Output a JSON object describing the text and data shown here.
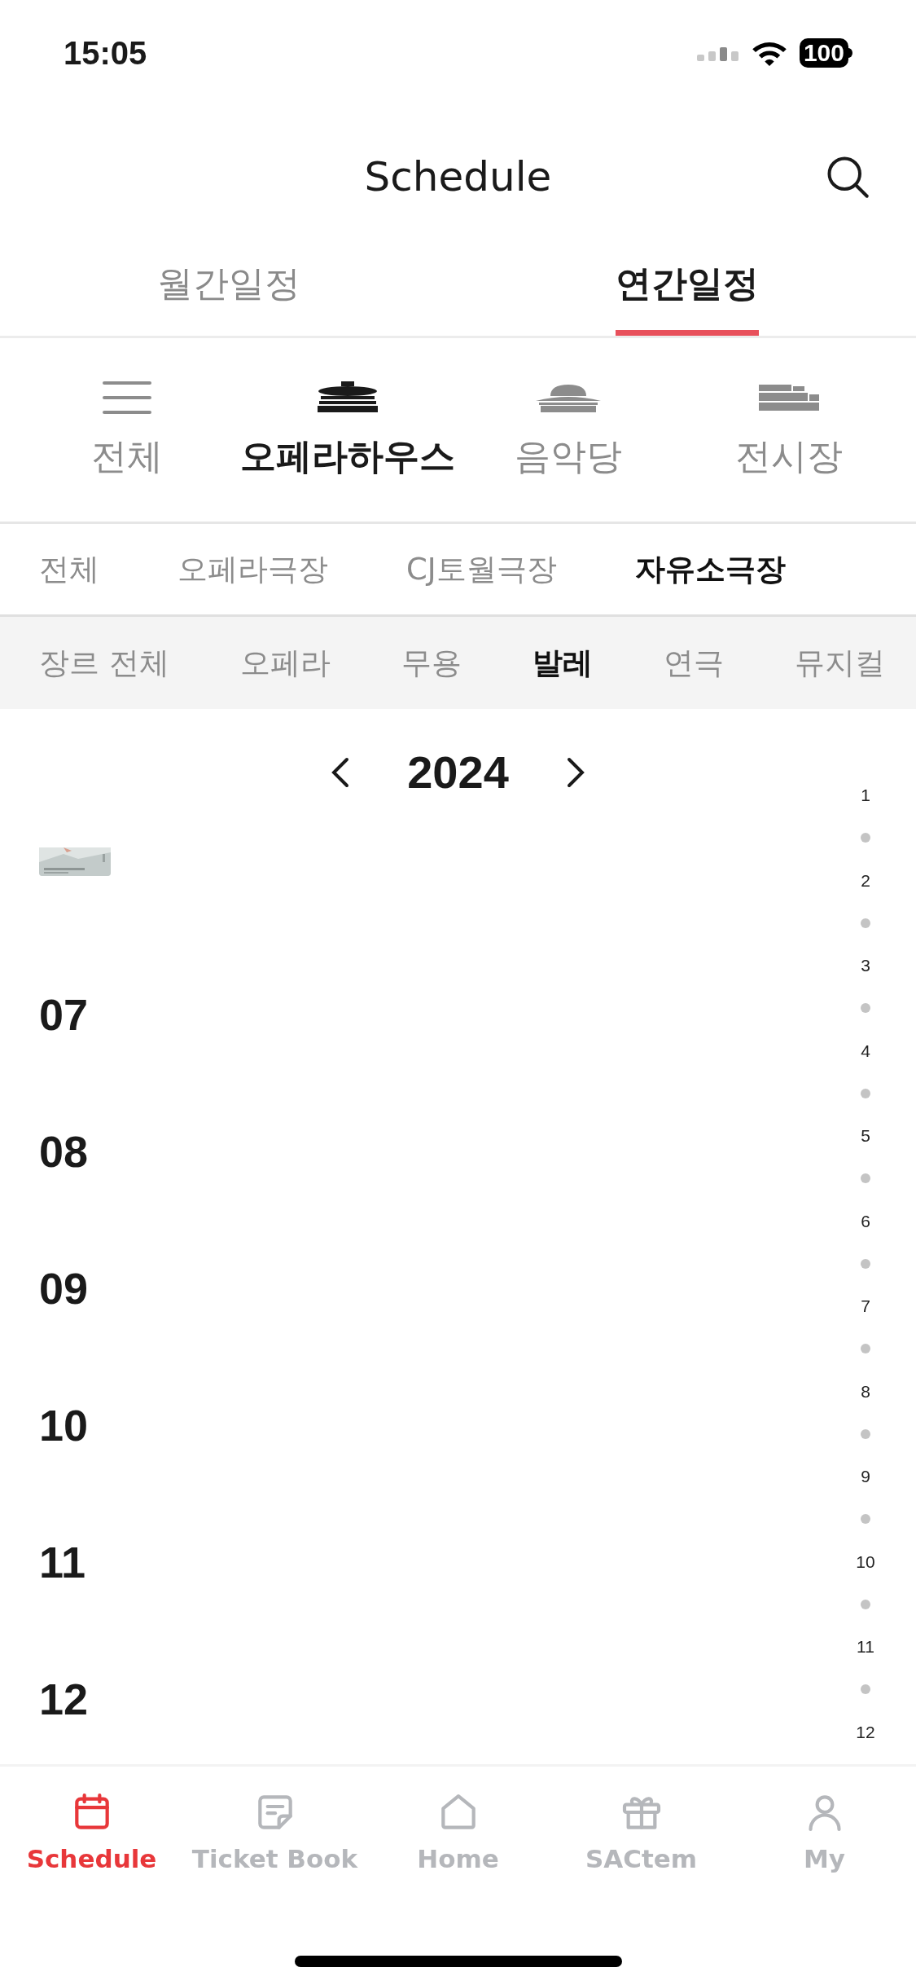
{
  "status_bar": {
    "time": "15:05",
    "battery": "100"
  },
  "header": {
    "title": "Schedule"
  },
  "view_tabs": [
    {
      "label": "월간일정",
      "selected": false
    },
    {
      "label": "연간일정",
      "selected": true
    }
  ],
  "venues": [
    {
      "label": "전체",
      "kind": "all",
      "selected": false
    },
    {
      "label": "오페라하우스",
      "kind": "opera_house",
      "selected": true
    },
    {
      "label": "음악당",
      "kind": "concert_hall",
      "selected": false
    },
    {
      "label": "전시장",
      "kind": "gallery",
      "selected": false
    }
  ],
  "halls": [
    {
      "label": "전체",
      "selected": false
    },
    {
      "label": "오페라극장",
      "selected": false
    },
    {
      "label": "CJ토월극장",
      "selected": false
    },
    {
      "label": "자유소극장",
      "selected": true
    }
  ],
  "genres": [
    {
      "label": "장르 전체",
      "selected": false
    },
    {
      "label": "오페라",
      "selected": false
    },
    {
      "label": "무용",
      "selected": false
    },
    {
      "label": "발레",
      "selected": true
    },
    {
      "label": "연극",
      "selected": false
    },
    {
      "label": "뮤지컬",
      "selected": false
    }
  ],
  "year": {
    "value": "2024"
  },
  "months": [
    "07",
    "08",
    "09",
    "10",
    "11",
    "12"
  ],
  "month_index": [
    "1",
    "2",
    "3",
    "4",
    "5",
    "6",
    "7",
    "8",
    "9",
    "10",
    "11",
    "12"
  ],
  "bottom_nav": [
    {
      "label": "Schedule",
      "kind": "calendar",
      "selected": true
    },
    {
      "label": "Ticket Book",
      "kind": "note",
      "selected": false
    },
    {
      "label": "Home",
      "kind": "home",
      "selected": false
    },
    {
      "label": "SACtem",
      "kind": "gift",
      "selected": false
    },
    {
      "label": "My",
      "kind": "user",
      "selected": false
    }
  ]
}
